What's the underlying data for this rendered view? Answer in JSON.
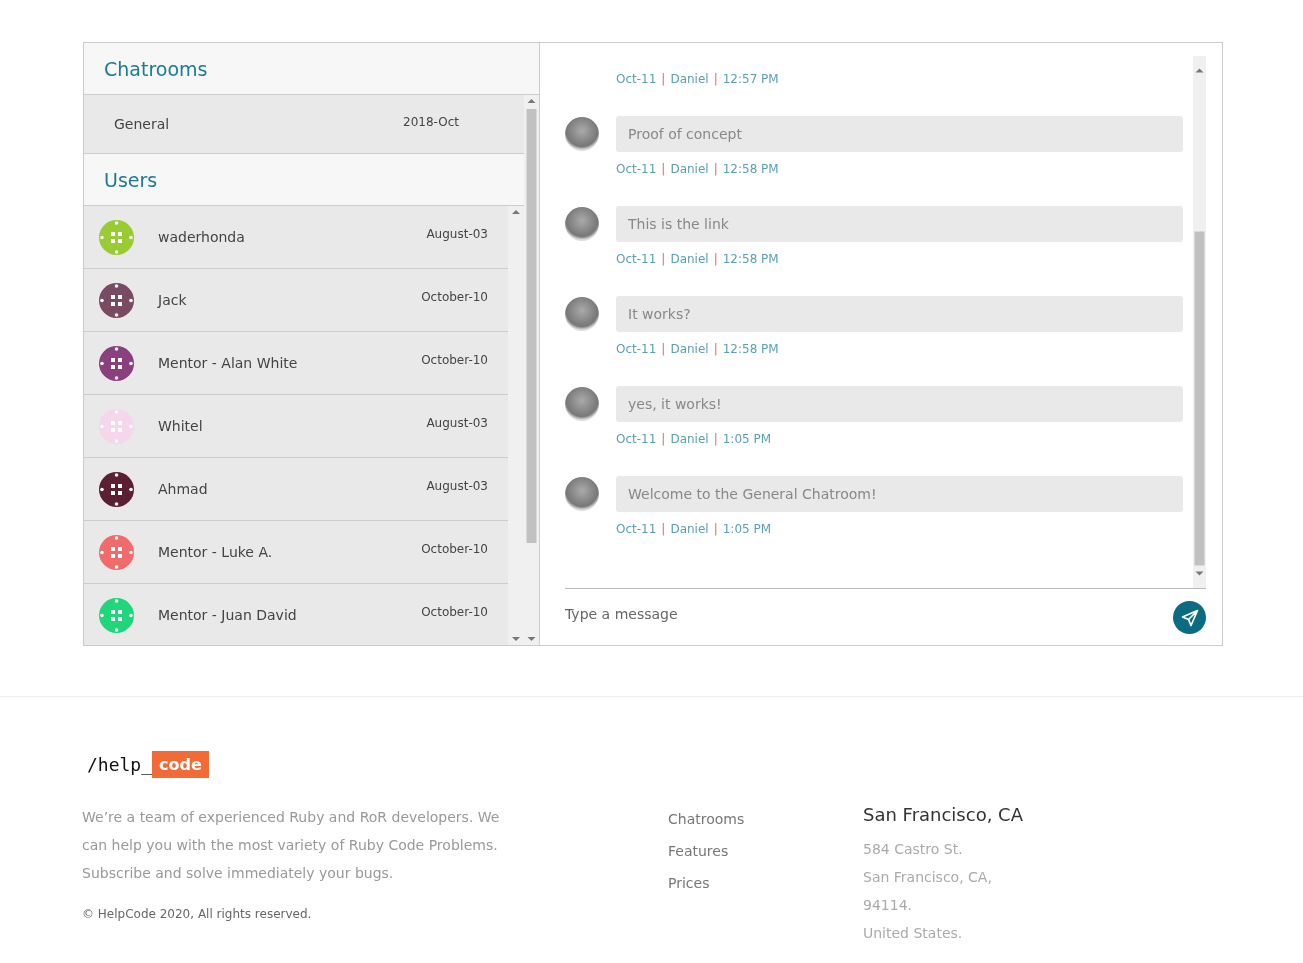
{
  "chatrooms": {
    "title": "Chatrooms",
    "rooms": [
      {
        "name": "General",
        "date": "2018-Oct"
      }
    ]
  },
  "users": {
    "title": "Users",
    "items": [
      {
        "name": "waderhonda",
        "date": "August-03",
        "color": "#99cc33"
      },
      {
        "name": "Jack",
        "date": "October-10",
        "color": "#7a4a63"
      },
      {
        "name": "Mentor - Alan White",
        "date": "October-10",
        "color": "#8a3f7f"
      },
      {
        "name": "Whitel",
        "date": "August-03",
        "color": "#f6d6ea"
      },
      {
        "name": "Ahmad",
        "date": "August-03",
        "color": "#5c1e33"
      },
      {
        "name": "Mentor - Luke A.",
        "date": "October-10",
        "color": "#f06b6b"
      },
      {
        "name": "Mentor - Juan David",
        "date": "October-10",
        "color": "#1fd67a"
      }
    ]
  },
  "messages": [
    {
      "meta": [
        {
          "kind": "text",
          "text": "Oct-11"
        },
        {
          "kind": "sep",
          "text": "|"
        },
        {
          "kind": "text",
          "text": "Daniel"
        },
        {
          "kind": "sep",
          "text": "|"
        },
        {
          "kind": "text",
          "text": "12:57 PM"
        }
      ]
    },
    {
      "text": "Proof of concept",
      "meta": [
        {
          "kind": "text",
          "text": "Oct-11"
        },
        {
          "kind": "sep",
          "text": "|"
        },
        {
          "kind": "text",
          "text": "Daniel"
        },
        {
          "kind": "sep",
          "text": "|"
        },
        {
          "kind": "text",
          "text": "12:58 PM"
        }
      ]
    },
    {
      "text": "This is the link",
      "meta": [
        {
          "kind": "text",
          "text": "Oct-11"
        },
        {
          "kind": "sep",
          "text": "|"
        },
        {
          "kind": "text",
          "text": "Daniel"
        },
        {
          "kind": "sep",
          "text": "|"
        },
        {
          "kind": "text",
          "text": "12:58 PM"
        }
      ]
    },
    {
      "text": "It works?",
      "meta": [
        {
          "kind": "text",
          "text": "Oct-11"
        },
        {
          "kind": "sep",
          "text": "|"
        },
        {
          "kind": "text",
          "text": "Daniel"
        },
        {
          "kind": "sep",
          "text": "|"
        },
        {
          "kind": "text",
          "text": "12:58 PM"
        }
      ]
    },
    {
      "text": "yes, it works!",
      "meta": [
        {
          "kind": "text",
          "text": "Oct-11"
        },
        {
          "kind": "sep",
          "text": "|"
        },
        {
          "kind": "text",
          "text": "Daniel"
        },
        {
          "kind": "sep",
          "text": "|"
        },
        {
          "kind": "text",
          "text": "1:05 PM"
        }
      ]
    },
    {
      "text": "Welcome to the General Chatroom!",
      "meta": [
        {
          "kind": "text",
          "text": "Oct-11"
        },
        {
          "kind": "sep",
          "text": "|"
        },
        {
          "kind": "text",
          "text": "Daniel"
        },
        {
          "kind": "sep",
          "text": "|"
        },
        {
          "kind": "text",
          "text": "1:05 PM"
        }
      ]
    }
  ],
  "composer": {
    "placeholder": "Type a message"
  },
  "footer": {
    "logo": {
      "prefix": "/help_",
      "highlight": "code"
    },
    "about": "We’re a team of experienced Ruby and RoR developers. We can help you with the most variety of Ruby Code Problems. Subscribe and solve immediately your bugs.",
    "copyright": "© HelpCode 2020, All rights reserved.",
    "links": [
      "Chatrooms",
      "Features",
      "Prices"
    ],
    "address": {
      "title": "San Francisco, CA",
      "lines": [
        "584 Castro St.",
        "San Francisco, CA,",
        "94114.",
        "United States."
      ]
    }
  }
}
